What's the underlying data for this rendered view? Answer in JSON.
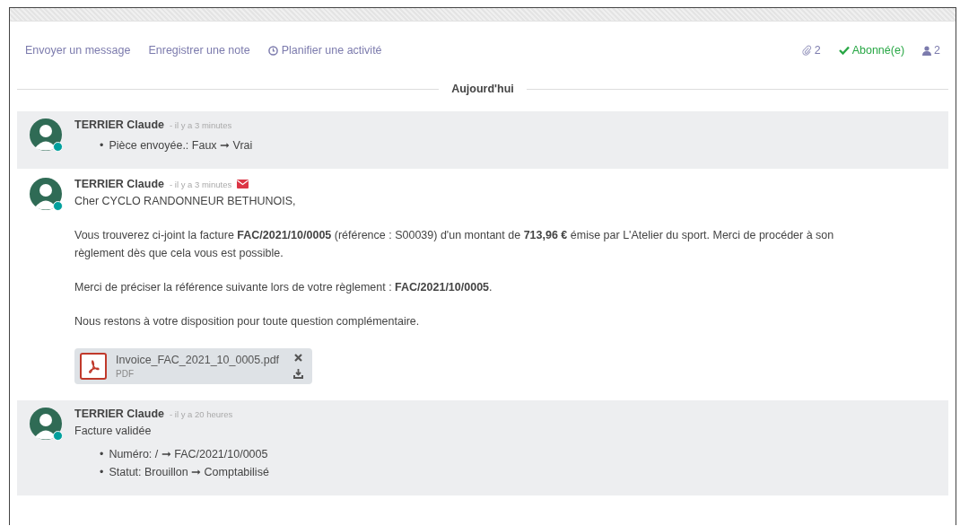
{
  "toolbar": {
    "actions": [
      {
        "label": "Envoyer un message",
        "kind": "message"
      },
      {
        "label": "Enregistrer une note",
        "kind": "note"
      },
      {
        "label": "Planifier une activité",
        "kind": "activity"
      }
    ],
    "attachments_count": "2",
    "follow": {
      "label": "Abonné(e)",
      "on": true
    },
    "followers_count": "2"
  },
  "date_separator": "Aujourd'hui",
  "messages": [
    {
      "kind": "notification",
      "author": "TERRIER Claude",
      "time": "- il y a 3 minutes",
      "emailed": false,
      "changes": [
        {
          "bullet": "•",
          "text": "Pièce envoyée.: Faux ➞ Vrai"
        }
      ]
    },
    {
      "kind": "message",
      "author": "TERRIER Claude",
      "time": "- il y a 3 minutes",
      "emailed": true,
      "body": [
        "Cher CYCLO RANDONNEUR BETHUNOIS,",
        "Vous trouverez ci-joint la facture **FAC/2021/10/0005** (référence : S00039) d'un montant de **713,96 €** émise par L'Atelier du sport. Merci de procéder à son règlement dès que cela vous est possible.",
        "Merci de préciser la référence suivante lors de votre règlement : **FAC/2021/10/0005**.",
        "Nous restons à votre disposition pour toute question complémentaire."
      ],
      "attachment": {
        "name": "Invoice_FAC_2021_10_0005.pdf",
        "type": "PDF"
      }
    },
    {
      "kind": "notification",
      "author": "TERRIER Claude",
      "time": "- il y a 20 heures",
      "emailed": false,
      "body": [
        "Facture validée"
      ],
      "changes": [
        {
          "bullet": "•",
          "text": "Numéro: / ➞ FAC/2021/10/0005"
        },
        {
          "bullet": "•",
          "text": "Statut: Brouillon ➞ Comptabilisé"
        }
      ]
    }
  ]
}
